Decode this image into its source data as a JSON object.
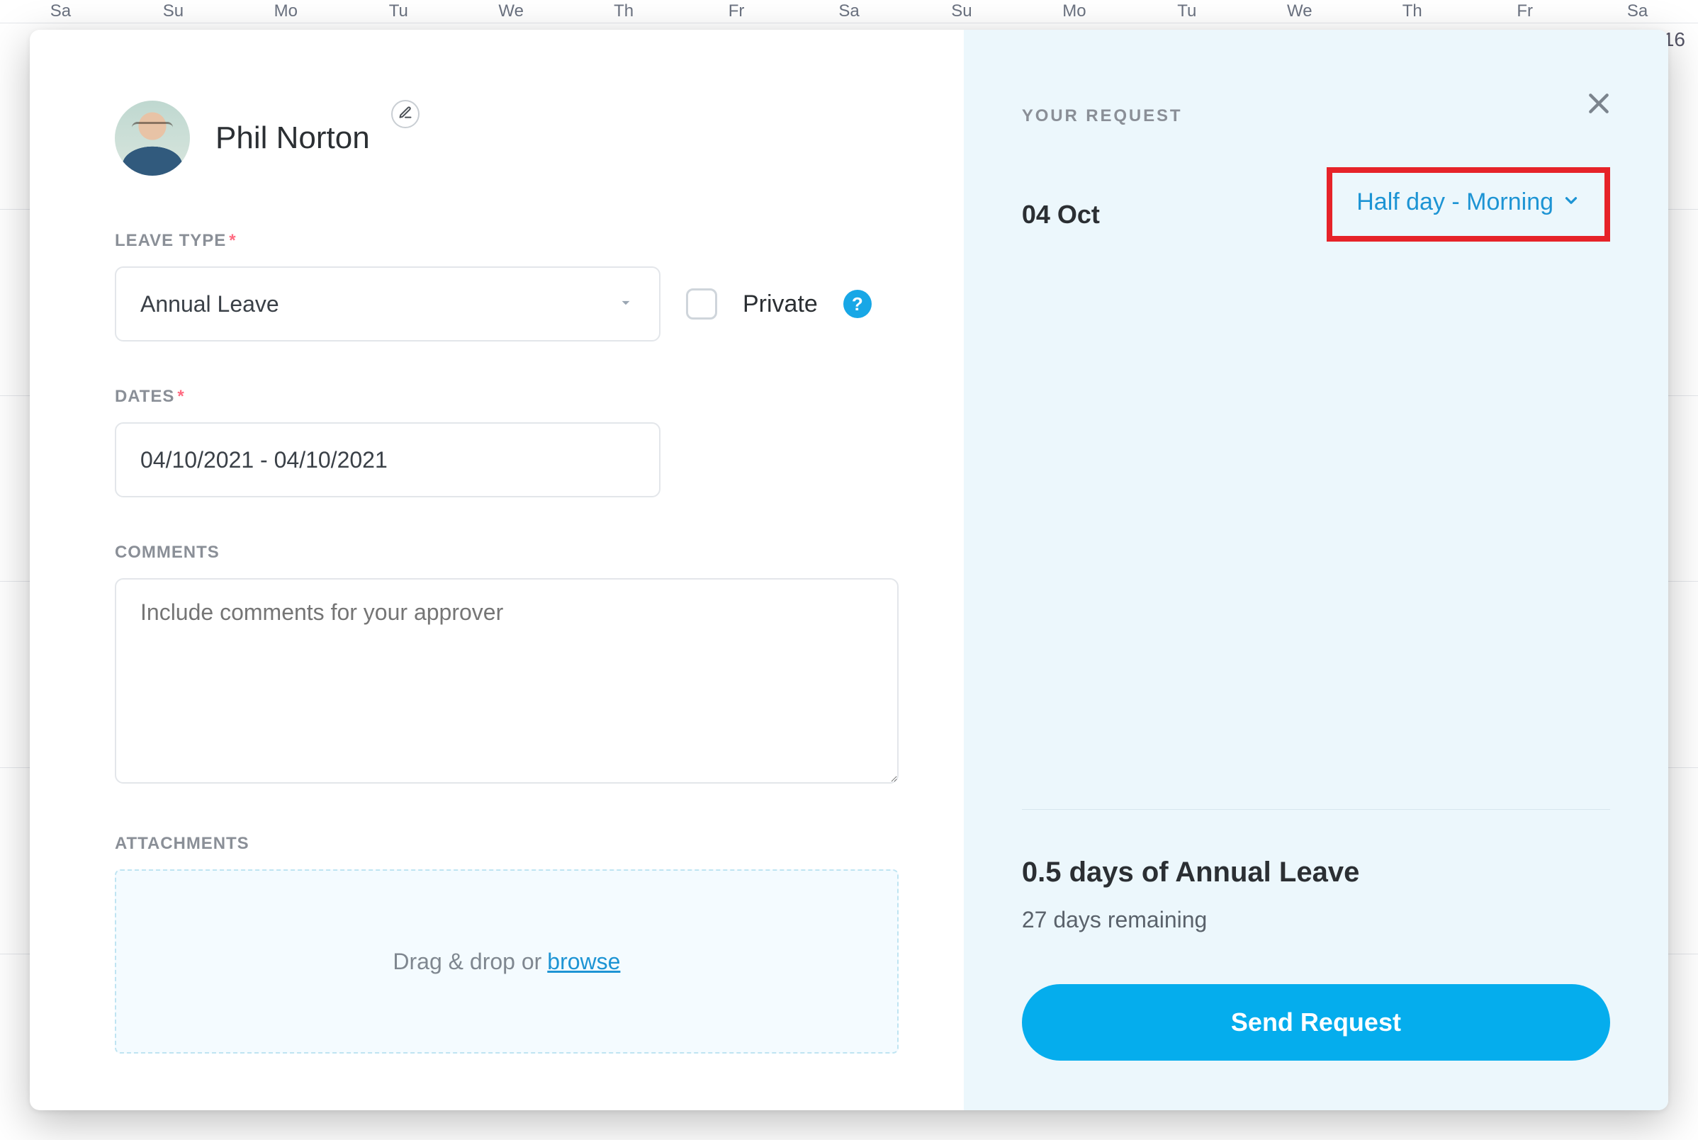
{
  "calendar": {
    "days": [
      "Sa",
      "Su",
      "Mo",
      "Tu",
      "We",
      "Th",
      "Fr",
      "Sa",
      "Su",
      "Mo",
      "Tu",
      "We",
      "Th",
      "Fr",
      "Sa"
    ],
    "visible_date_number": "16"
  },
  "person": {
    "name": "Phil Norton"
  },
  "labels": {
    "leave_type": "LEAVE TYPE",
    "dates": "DATES",
    "comments": "COMMENTS",
    "attachments": "ATTACHMENTS",
    "private": "Private",
    "your_request": "YOUR REQUEST"
  },
  "leave_type": {
    "selected": "Annual Leave"
  },
  "dates": {
    "value": "04/10/2021 - 04/10/2021"
  },
  "comments": {
    "placeholder": "Include comments for your approver"
  },
  "attachments": {
    "text": "Drag & drop or",
    "link": "browse"
  },
  "request": {
    "date": "04 Oct",
    "duration_label": "Half day - Morning"
  },
  "summary": {
    "title": "0.5 days of Annual Leave",
    "remaining": "27 days remaining"
  },
  "buttons": {
    "send": "Send Request"
  }
}
